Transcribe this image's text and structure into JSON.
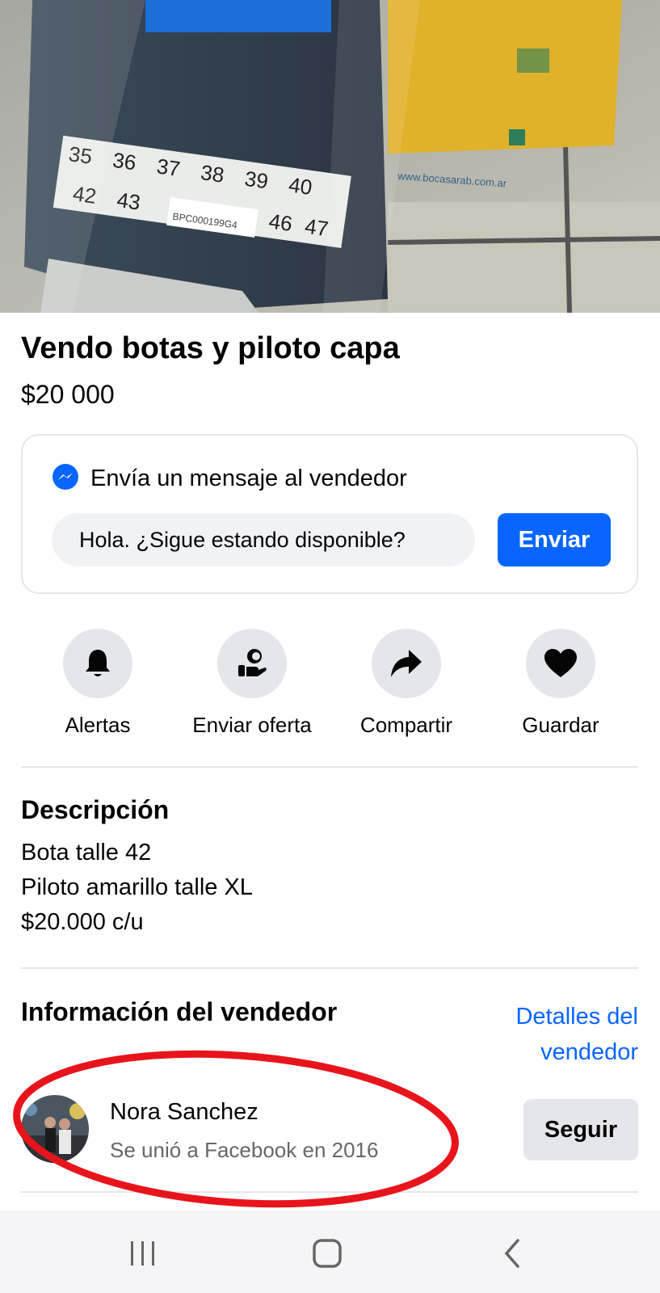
{
  "listing": {
    "title": "Vendo botas y piloto capa",
    "price": "$20 000",
    "photo_labels": {
      "sizes_row1": [
        "35",
        "36",
        "37",
        "38",
        "39",
        "40"
      ],
      "sizes_row2": [
        "42",
        "43",
        "46",
        "47"
      ],
      "barcode": "BPC000199G4",
      "website": "www.bocasarab.com.ar"
    }
  },
  "message": {
    "icon": "messenger-icon",
    "heading": "Envía un mensaje al vendedor",
    "input_value": "Hola. ¿Sigue estando disponible?",
    "send_label": "Enviar"
  },
  "actions": [
    {
      "label": "Alertas",
      "icon": "bell-icon"
    },
    {
      "label": "Enviar oferta",
      "icon": "offer-icon"
    },
    {
      "label": "Compartir",
      "icon": "share-icon"
    },
    {
      "label": "Guardar",
      "icon": "heart-icon"
    }
  ],
  "description": {
    "heading": "Descripción",
    "lines": [
      "Bota talle 42",
      "Piloto amarillo talle XL",
      "$20.000 c/u"
    ]
  },
  "seller": {
    "heading": "Información del vendedor",
    "details_link": [
      "Detalles del",
      "vendedor"
    ],
    "name": "Nora Sanchez",
    "joined": "Se unió a Facebook en 2016",
    "follow_label": "Seguir"
  },
  "colors": {
    "accent": "#0866ff",
    "button_bg": "#e4e6eb",
    "annotation": "#e8141c"
  },
  "system_nav": [
    "recent-apps-icon",
    "home-icon",
    "back-icon"
  ]
}
